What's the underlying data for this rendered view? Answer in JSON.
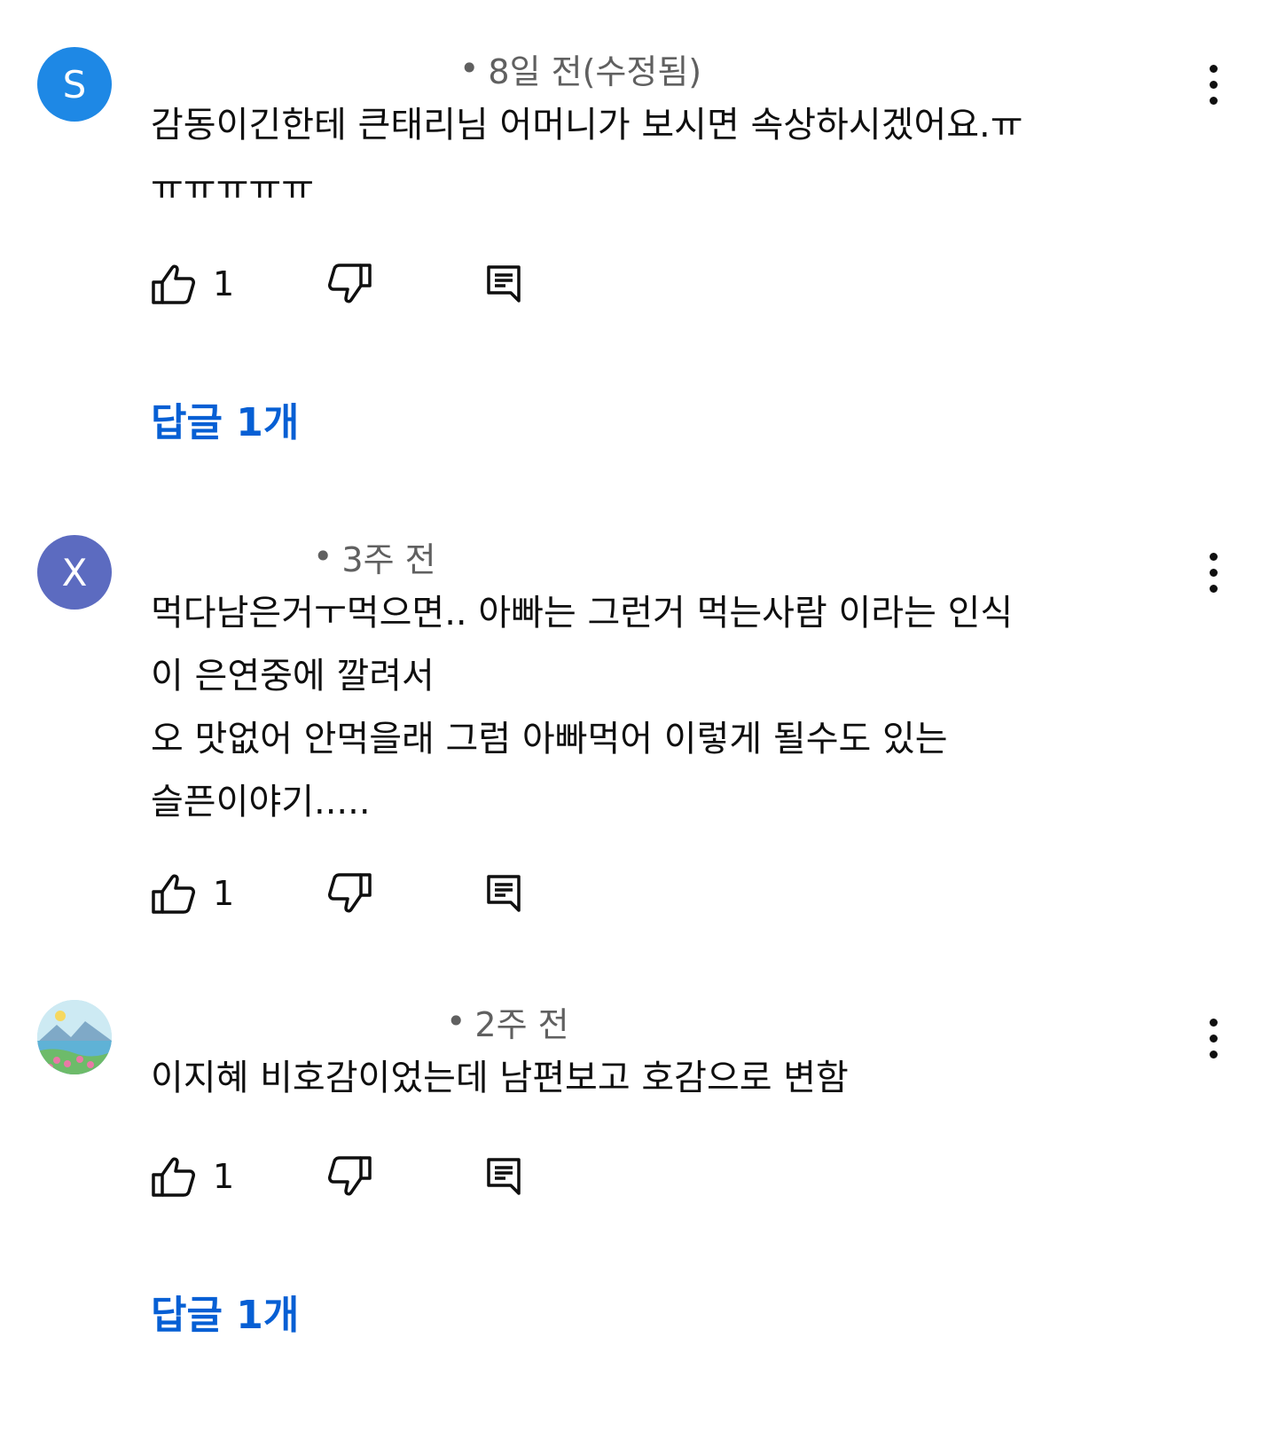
{
  "comments": [
    {
      "avatar_letter": "S",
      "avatar_color": "#1e88e5",
      "author": "",
      "time": "8일 전(수정됨)",
      "text": "감동이긴한테 큰태리님 어머니가 보시면 속상하시겠어요.ㅠ\nㅠㅠㅠㅠㅠ",
      "like_count": "1",
      "replies_label": "답글 1개"
    },
    {
      "avatar_letter": "X",
      "avatar_color": "#5c6bc0",
      "author": "",
      "time": "3주 전",
      "text": "먹다남은거ㅜ먹으면.. 아빠는 그런거 먹는사람 이라는 인식\n이 은연중에 깔려서\n오 맛없어 안먹을래 그럼 아빠먹어 이렇게 될수도 있는\n슬픈이야기.....",
      "like_count": "1"
    },
    {
      "avatar_letter": "",
      "avatar_color": "#a8d8e8",
      "author": "",
      "time": "2주 전",
      "text": "이지혜 비호감이었는데 남편보고 호감으로 변함",
      "like_count": "1",
      "replies_label": "답글 1개"
    }
  ],
  "icons": {
    "like": "thumbs-up-icon",
    "dislike": "thumbs-down-icon",
    "reply": "comment-reply-icon",
    "more": "more-vertical-icon"
  },
  "colors": {
    "link": "#065fd4",
    "meta": "#606060",
    "text": "#0f0f0f"
  }
}
